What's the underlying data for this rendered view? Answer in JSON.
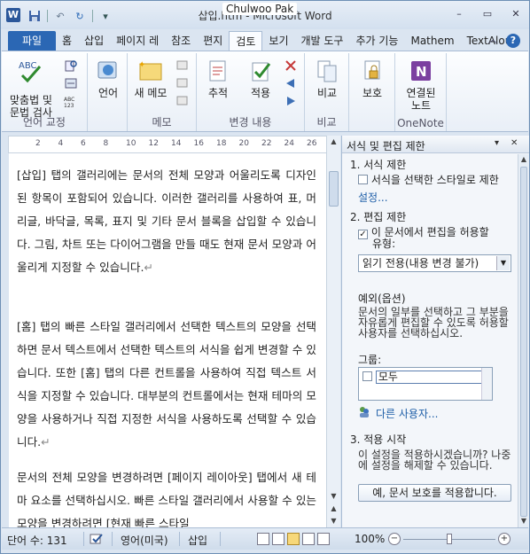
{
  "window": {
    "title": "삽입.htm - Microsoft Word",
    "user": "Chulwoo Pak",
    "app_letter": "W",
    "controls": {
      "minimize": "–",
      "restore": "▭",
      "close": "✕"
    }
  },
  "qat": {
    "save": "💾",
    "undo": "↶",
    "redo": "↻",
    "customize": "▾"
  },
  "tabs": [
    "파일",
    "홈",
    "삽입",
    "페이지 레",
    "참조",
    "편지",
    "검토",
    "보기",
    "개발 도구",
    "추가 기능",
    "Mathem",
    "TextAlou"
  ],
  "active_tab": "검토",
  "tab_right": {
    "collapse": "︿",
    "help": "?"
  },
  "ribbon": {
    "groups": {
      "proofing": "언어 교정",
      "memo": "메모",
      "tracking": "변경 내용",
      "compare": "비교",
      "protect": "",
      "onenote": "OneNote"
    },
    "buttons": {
      "spelling_line1": "맞춤법 및",
      "spelling_line2": "문법 검사",
      "language": "언어",
      "new_memo": "새 메모",
      "track": "추적",
      "accept": "적용",
      "compare": "비교",
      "protect": "보호",
      "linked_notes_line1": "연결된",
      "linked_notes_line2": "노트"
    }
  },
  "ruler": {
    "ticks": [
      "2",
      "4",
      "6",
      "8",
      "10",
      "12",
      "14",
      "16",
      "18",
      "20",
      "22",
      "24",
      "26",
      "2"
    ]
  },
  "document": {
    "paragraphs": [
      "[삽입] 탭의 갤러리에는 문서의 전체 모양과 어울리도록 디자인된 항목이 포함되어 있습니다. 이러한 갤러리를 사용하여 표, 머리글, 바닥글, 목록, 표지 및 기타 문서 블록을 삽입할 수 있습니다. 그림, 차트 또는 다이어그램을 만들 때도 현재 문서 모양과 어울리게 지정할 수 있습니다.",
      "[홈] 탭의 빠른 스타일 갤러리에서 선택한 텍스트의 모양을 선택하면 문서 텍스트에서 선택한 텍스트의 서식을 쉽게 변경할 수 있습니다. 또한 [홈] 탭의 다른 컨트롤을 사용하여 직접 텍스트 서식을 지정할 수 있습니다. 대부분의 컨트롤에서는 현재 테마의 모양을 사용하거나 직접 지정한 서식을 사용하도록 선택할 수 있습니다.",
      "문서의 전체 모양을 변경하려면 [페이지 레이아웃] 탭에서 새 테마 요소를 선택하십시오. 빠른 스타일 갤러리에서 사용할 수 있는 모양을 변경하려면 [현재 빠른 스타일"
    ],
    "pilcrow": "↵"
  },
  "pane": {
    "title": "서식 및 편집 제한",
    "dropdown": "▾",
    "close": "✕",
    "section1": {
      "title": "1. 서식 제한",
      "checkbox_label": "서식을 선택한 스타일로 제한",
      "checked": false,
      "settings_link": "설정..."
    },
    "section2": {
      "title": "2. 편집 제한",
      "checkbox_label_line1": "이 문서에서 편집을 허용할",
      "checkbox_label_line2": "유형:",
      "checked": true,
      "select_value": "읽기 전용(내용 변경 불가)",
      "exceptions_title": "예외(옵션)",
      "exceptions_desc": "문서의 일부를 선택하고 그 부분을 자유롭게 편집할 수 있도록 허용할 사용자를 선택하십시오.",
      "groups_label": "그룹:",
      "group_item": "모두",
      "more_users_link": "다른 사용자..."
    },
    "section3": {
      "title": "3. 적용 시작",
      "desc": "이 설정을 적용하시겠습니까? 나중에 설정을 해제할 수 있습니다.",
      "button": "예, 문서 보호를 적용합니다."
    }
  },
  "statusbar": {
    "word_count": "단어 수: 131",
    "language": "영어(미국)",
    "mode": "삽입",
    "zoom": "100%"
  }
}
